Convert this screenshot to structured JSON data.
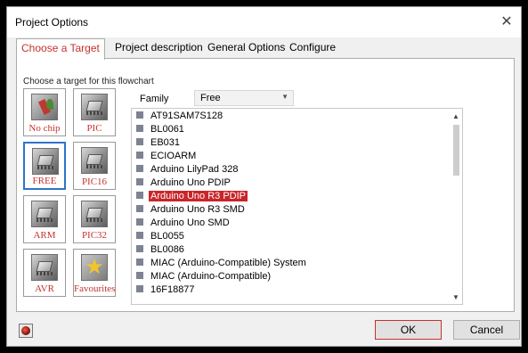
{
  "window": {
    "title": "Project Options",
    "close_icon": "close-icon"
  },
  "tabs": [
    {
      "label": "Choose a Target",
      "active": true
    },
    {
      "label": "Project description",
      "active": false
    },
    {
      "label": "General Options",
      "active": false
    },
    {
      "label": "Configure",
      "active": false
    }
  ],
  "panel": {
    "choose_label": "Choose a target for this flowchart",
    "family_label": "Family",
    "family_value": "Free"
  },
  "targets": [
    {
      "label": "No chip",
      "icon": "no-chip-icon",
      "selected": false
    },
    {
      "label": "PIC",
      "icon": "chip-icon",
      "selected": false
    },
    {
      "label": "FREE",
      "icon": "chip-icon",
      "selected": true
    },
    {
      "label": "PIC16",
      "icon": "chip-icon",
      "selected": false
    },
    {
      "label": "ARM",
      "icon": "chip-icon",
      "selected": false
    },
    {
      "label": "PIC32",
      "icon": "chip-icon",
      "selected": false
    },
    {
      "label": "AVR",
      "icon": "chip-icon",
      "selected": false
    },
    {
      "label": "Favourites",
      "icon": "star-icon",
      "selected": false
    }
  ],
  "devices": [
    "AT91SAM7S128",
    "BL0061",
    "EB031",
    "ECIOARM",
    "Arduino LilyPad 328",
    "Arduino Uno PDIP",
    "Arduino Uno R3 PDIP",
    "Arduino Uno R3 SMD",
    "Arduino Uno SMD",
    "BL0055",
    "BL0086",
    "MIAC (Arduino-Compatible) System",
    "MIAC (Arduino-Compatible)",
    "16F18877"
  ],
  "selected_device": "Arduino Uno R3 PDIP",
  "buttons": {
    "ok": "OK",
    "cancel": "Cancel"
  },
  "colors": {
    "accent": "#c4322d",
    "selection": "#c8262a",
    "focus": "#2f73c8"
  }
}
